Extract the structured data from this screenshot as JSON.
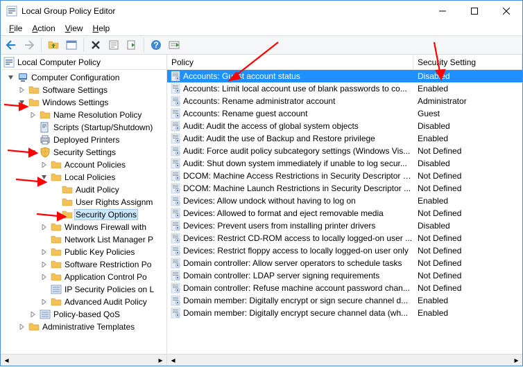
{
  "window": {
    "title": "Local Group Policy Editor"
  },
  "menu": {
    "file": "File",
    "action": "Action",
    "view": "View",
    "help": "Help"
  },
  "tree_header": "Local Computer Policy",
  "tree": [
    {
      "depth": 0,
      "exp": "open",
      "icon": "computer",
      "label": "Computer Configuration"
    },
    {
      "depth": 1,
      "exp": "closed",
      "icon": "folder",
      "label": "Software Settings"
    },
    {
      "depth": 1,
      "exp": "open",
      "icon": "folder",
      "label": "Windows Settings"
    },
    {
      "depth": 2,
      "exp": "closed",
      "icon": "folder",
      "label": "Name Resolution Policy"
    },
    {
      "depth": 2,
      "exp": "none",
      "icon": "script",
      "label": "Scripts (Startup/Shutdown)"
    },
    {
      "depth": 2,
      "exp": "none",
      "icon": "printer",
      "label": "Deployed Printers"
    },
    {
      "depth": 2,
      "exp": "open",
      "icon": "shield",
      "label": "Security Settings"
    },
    {
      "depth": 3,
      "exp": "closed",
      "icon": "folder",
      "label": "Account Policies"
    },
    {
      "depth": 3,
      "exp": "open",
      "icon": "folder",
      "label": "Local Policies"
    },
    {
      "depth": 4,
      "exp": "none",
      "icon": "folder",
      "label": "Audit Policy"
    },
    {
      "depth": 4,
      "exp": "none",
      "icon": "folder",
      "label": "User Rights Assignm"
    },
    {
      "depth": 4,
      "exp": "none",
      "icon": "folder",
      "label": "Security Options",
      "sel": true
    },
    {
      "depth": 3,
      "exp": "closed",
      "icon": "folder",
      "label": "Windows Firewall with "
    },
    {
      "depth": 3,
      "exp": "none",
      "icon": "folder",
      "label": "Network List Manager P"
    },
    {
      "depth": 3,
      "exp": "closed",
      "icon": "folder",
      "label": "Public Key Policies"
    },
    {
      "depth": 3,
      "exp": "closed",
      "icon": "folder",
      "label": "Software Restriction Po"
    },
    {
      "depth": 3,
      "exp": "closed",
      "icon": "folder",
      "label": "Application Control Po"
    },
    {
      "depth": 3,
      "exp": "none",
      "icon": "list",
      "label": "IP Security Policies on L"
    },
    {
      "depth": 3,
      "exp": "closed",
      "icon": "folder",
      "label": "Advanced Audit Policy"
    },
    {
      "depth": 2,
      "exp": "closed",
      "icon": "list",
      "label": "Policy-based QoS"
    },
    {
      "depth": 1,
      "exp": "closed",
      "icon": "folder",
      "label": "Administrative Templates"
    }
  ],
  "columns": {
    "policy": "Policy",
    "setting": "Security Setting"
  },
  "rows": [
    {
      "p": "Accounts: Guest account status",
      "s": "Disabled",
      "sel": true
    },
    {
      "p": "Accounts: Limit local account use of blank passwords to co...",
      "s": "Enabled"
    },
    {
      "p": "Accounts: Rename administrator account",
      "s": "Administrator"
    },
    {
      "p": "Accounts: Rename guest account",
      "s": "Guest"
    },
    {
      "p": "Audit: Audit the access of global system objects",
      "s": "Disabled"
    },
    {
      "p": "Audit: Audit the use of Backup and Restore privilege",
      "s": "Enabled"
    },
    {
      "p": "Audit: Force audit policy subcategory settings (Windows Vis...",
      "s": "Not Defined"
    },
    {
      "p": "Audit: Shut down system immediately if unable to log secur...",
      "s": "Disabled"
    },
    {
      "p": "DCOM: Machine Access Restrictions in Security Descriptor D...",
      "s": "Not Defined"
    },
    {
      "p": "DCOM: Machine Launch Restrictions in Security Descriptor ...",
      "s": "Not Defined"
    },
    {
      "p": "Devices: Allow undock without having to log on",
      "s": "Enabled"
    },
    {
      "p": "Devices: Allowed to format and eject removable media",
      "s": "Not Defined"
    },
    {
      "p": "Devices: Prevent users from installing printer drivers",
      "s": "Disabled"
    },
    {
      "p": "Devices: Restrict CD-ROM access to locally logged-on user ...",
      "s": "Not Defined"
    },
    {
      "p": "Devices: Restrict floppy access to locally logged-on user only",
      "s": "Not Defined"
    },
    {
      "p": "Domain controller: Allow server operators to schedule tasks",
      "s": "Not Defined"
    },
    {
      "p": "Domain controller: LDAP server signing requirements",
      "s": "Not Defined"
    },
    {
      "p": "Domain controller: Refuse machine account password chan...",
      "s": "Not Defined"
    },
    {
      "p": "Domain member: Digitally encrypt or sign secure channel d...",
      "s": "Enabled"
    },
    {
      "p": "Domain member: Digitally encrypt secure channel data (wh...",
      "s": "Enabled"
    }
  ]
}
